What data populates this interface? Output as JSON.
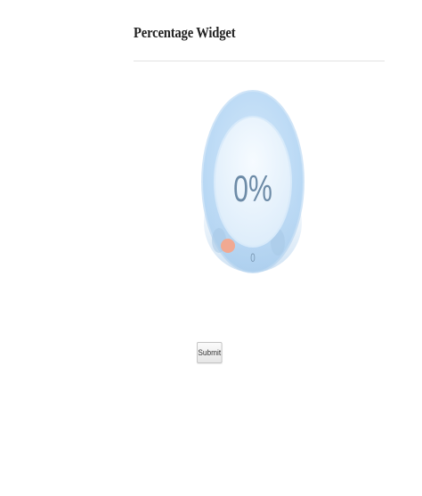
{
  "page": {
    "title": "Percentage Widget"
  },
  "widget": {
    "percent_label": "0%",
    "value_label": "0",
    "percent": 0,
    "colors": {
      "outer_ring": "#b9d9f5",
      "inner_face": "#e8f3fc",
      "text": "#6d8ba7",
      "handle": "#f4a68c"
    }
  },
  "form": {
    "submit_label": "Submit"
  }
}
